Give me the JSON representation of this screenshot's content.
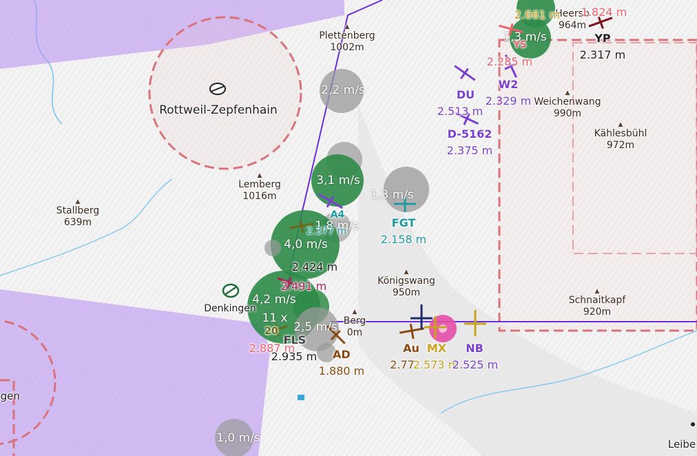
{
  "colors": {
    "airspace_purple": "#b68cf0",
    "route_line": "#6a2ee0",
    "thermal_strong": "#2e8b48",
    "thermal_weak": "#9a9a9a",
    "restricted_red": "#d9737a",
    "peak_brown": "#5a4033",
    "teal": "#1f9ba0",
    "violet": "#7a3fd0",
    "amber": "#c9a21f",
    "brown": "#8a4a10",
    "coral": "#f0606a",
    "dark": "#222222"
  },
  "airfields": [
    {
      "name": "Rottweil-Zepfenhain",
      "icon": "airfield-icon"
    },
    {
      "name": "Denkingen",
      "icon": "glider-airfield-icon"
    },
    {
      "name": "ngen",
      "icon": "airfield-icon"
    },
    {
      "name": "Leibe",
      "icon": "airfield-icon"
    }
  ],
  "peaks": [
    {
      "name": "Plettenberg",
      "elev": "1002m"
    },
    {
      "name": "Lemberg",
      "elev": "1016m"
    },
    {
      "name": "Stallberg",
      "elev": "639m"
    },
    {
      "name": "Weichenwang",
      "elev": "990m"
    },
    {
      "name": "Kählesbühl",
      "elev": "972m"
    },
    {
      "name": "Königswang",
      "elev": "950m"
    },
    {
      "name": "Schnaitkapf",
      "elev": "920m"
    },
    {
      "name": "Heersb",
      "elev": "964m"
    },
    {
      "name": "Berg",
      "elev": "0m"
    }
  ],
  "thermals": [
    {
      "label": "2,2 m/s",
      "strength": "weak"
    },
    {
      "label": "3,1 m/s",
      "strength": "strong"
    },
    {
      "label": "1,3 m/s",
      "strength": "weak"
    },
    {
      "label": "1,8 m/s",
      "strength": "weak"
    },
    {
      "label": "4,0 m/s",
      "strength": "strong"
    },
    {
      "label": "4,2 m/s",
      "strength": "strong"
    },
    {
      "label": "11 x",
      "strength": "strong"
    },
    {
      "label": "2,5 m/s",
      "strength": "weak"
    },
    {
      "label": "1,0 m/s",
      "strength": "weak"
    },
    {
      "label": "1,3 m/s",
      "strength": "strong"
    }
  ],
  "gliders": [
    {
      "id": "DU",
      "alt": "2.513 m",
      "color": "#7a3fd0"
    },
    {
      "id": "W2",
      "alt": "2.329 m",
      "color": "#7a3fd0"
    },
    {
      "id": "D-5162",
      "alt": "2.375 m",
      "color": "#7a3fd0"
    },
    {
      "id": "YP",
      "alt": "2.317 m",
      "color": "#222222"
    },
    {
      "id": "FGT",
      "alt": "2.158 m",
      "color": "#1f9ba0"
    },
    {
      "id": "A4",
      "alt": "2.377 m",
      "color": "#1f9ba0"
    },
    {
      "id": "FLS",
      "alt": "2.935 m",
      "color": "#222222"
    },
    {
      "id": "AD",
      "alt": "1.880 m",
      "color": "#8a4a10"
    },
    {
      "id": "Au",
      "alt": "2.77",
      "color": "#8a4a10"
    },
    {
      "id": "MX",
      "alt": "2.573 m",
      "color": "#c9a21f"
    },
    {
      "id": "NB",
      "alt": "2.525 m",
      "color": "#7a3fd0"
    },
    {
      "id": "20",
      "alt": "",
      "color": "#6a6a1a"
    },
    {
      "id": "YS",
      "alt": "2.285 m",
      "color": "#f0606a"
    }
  ],
  "altitudes": [
    {
      "text": "2.661 m",
      "color": "#c9a21f"
    },
    {
      "text": "1.824 m",
      "color": "#f0606a"
    },
    {
      "text": "2.424 m",
      "color": "#222222"
    },
    {
      "text": "2.491 m",
      "color": "#b0205a"
    },
    {
      "text": "2.887 m",
      "color": "#f0606a"
    }
  ]
}
